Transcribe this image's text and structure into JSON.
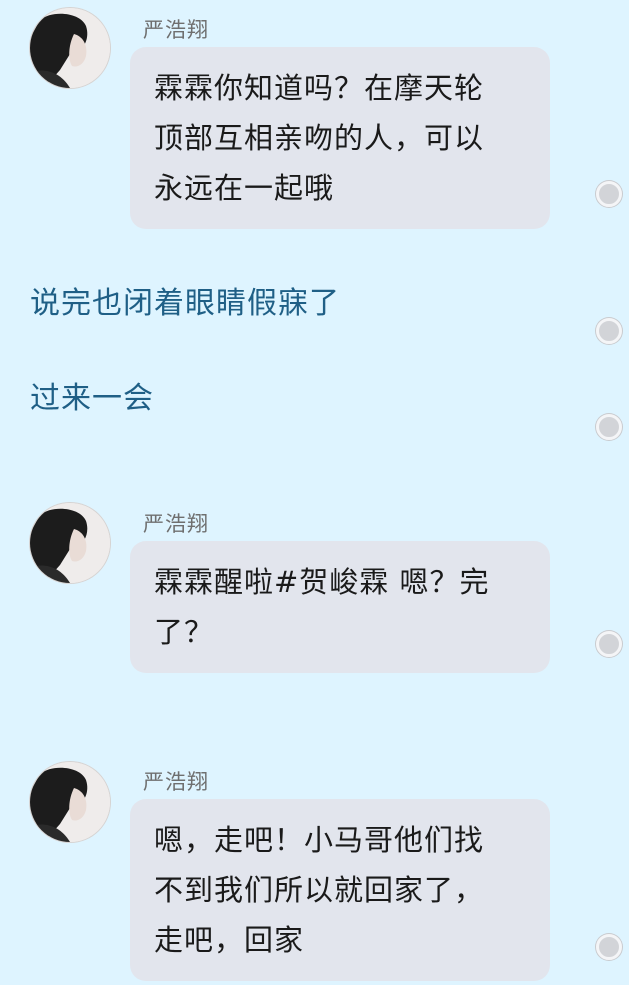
{
  "messages": [
    {
      "type": "chat",
      "sender": "严浩翔",
      "lines": [
        "霖霖你知道吗？在摩天轮",
        "顶部互相亲吻的人，可以",
        "永远在一起哦"
      ]
    },
    {
      "type": "narration",
      "text": "说完也闭着眼睛假寐了"
    },
    {
      "type": "narration",
      "text": "过来一会"
    },
    {
      "type": "chat",
      "sender": "严浩翔",
      "lines": [
        "霖霖醒啦#贺峻霖 嗯？完",
        "了？"
      ]
    },
    {
      "type": "chat",
      "sender": "严浩翔",
      "lines": [
        "嗯，走吧！小马哥他们找",
        "不到我们所以就回家了，",
        "走吧，回家"
      ]
    }
  ],
  "colors": {
    "background": "#def4ff",
    "bubble": "#e2e5ed",
    "narration_text": "#1f5f86",
    "sender_text": "#6f6f6f"
  },
  "icons": {
    "avatar": "profile-avatar-icon",
    "comment_dot": "comment-dot-icon"
  }
}
